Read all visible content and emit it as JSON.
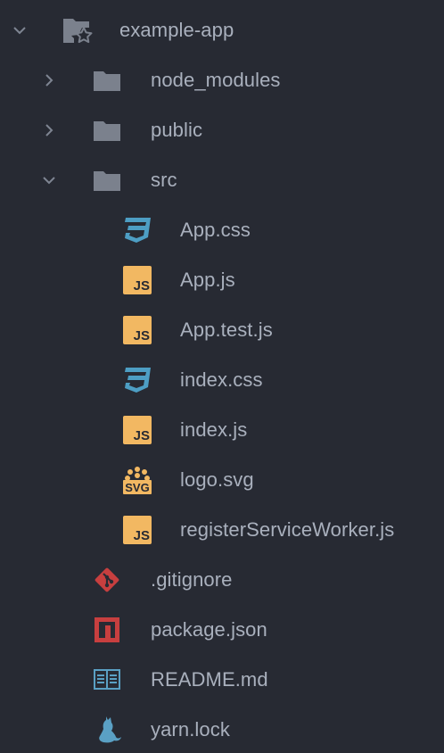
{
  "tree": {
    "root": {
      "label": "example-app",
      "icon": "folder-star-icon",
      "expanded": true
    },
    "folders": [
      {
        "label": "node_modules",
        "icon": "folder-icon",
        "expanded": false
      },
      {
        "label": "public",
        "icon": "folder-icon",
        "expanded": false
      },
      {
        "label": "src",
        "icon": "folder-icon",
        "expanded": true
      }
    ],
    "src_files": [
      {
        "label": "App.css",
        "icon": "css3-icon"
      },
      {
        "label": "App.js",
        "icon": "js-icon",
        "badge": "JS"
      },
      {
        "label": "App.test.js",
        "icon": "js-icon",
        "badge": "JS"
      },
      {
        "label": "index.css",
        "icon": "css3-icon"
      },
      {
        "label": "index.js",
        "icon": "js-icon",
        "badge": "JS"
      },
      {
        "label": "logo.svg",
        "icon": "svg-icon",
        "badge": "SVG"
      },
      {
        "label": "registerServiceWorker.js",
        "icon": "js-icon",
        "badge": "JS"
      }
    ],
    "root_files": [
      {
        "label": ".gitignore",
        "icon": "git-icon"
      },
      {
        "label": "package.json",
        "icon": "npm-icon"
      },
      {
        "label": "README.md",
        "icon": "book-icon"
      },
      {
        "label": "yarn.lock",
        "icon": "yarn-cat-icon"
      }
    ]
  },
  "colors": {
    "background": "#272a33",
    "text": "#a9b0bd",
    "chevron": "#7e8592",
    "folder": "#7b818d",
    "js": "#f2b862",
    "css": "#4d9ec4",
    "git": "#c73f3f",
    "npm": "#c73f3f",
    "readme": "#5aa0c4",
    "yarn": "#5aa0c4",
    "svg": "#f2b862"
  }
}
